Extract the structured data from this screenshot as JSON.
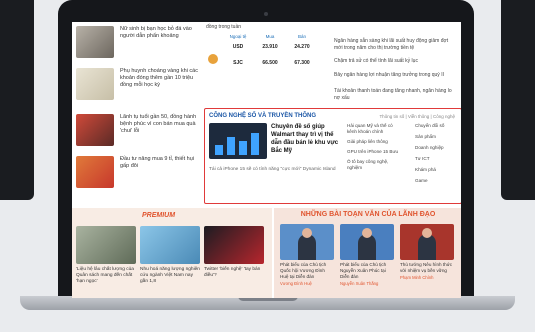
{
  "left_news": [
    {
      "title": "Nữ sinh bị bạn học bỏ đá vào người dẫn phẩn khoảng",
      "meta": "4h"
    },
    {
      "title": "Phụ huynh choáng vàng khi các khoản đóng thêm gần 10 triệu đồng mỗi học kỳ",
      "meta": "4h"
    },
    {
      "title": "Lãnh tụ tuổi gần 50, đồng hành bệnh phúc vì con bán mua quà 'chui' lỗi",
      "meta": "4h"
    },
    {
      "title": "Đầu tư nâng mua 9 tỉ, thiết hụi gấp đôi",
      "meta": "4h"
    }
  ],
  "stats": {
    "heading": "đồng trong tuần",
    "labels": [
      "Ngoại tệ",
      "Mua",
      "Bán"
    ],
    "rows": [
      {
        "label": "USD",
        "buy": "23.910",
        "sell": "24.270"
      },
      {
        "label": "SJC",
        "buy": "66.500",
        "sell": "67.300"
      }
    ]
  },
  "right_text": [
    "Ngân hàng sẵn sàng khi lãi suất huy động giảm đợt mới trong năm cho thị trường tiền tệ",
    "Chậm trả sử có thể tính lãi suất kỷ lục",
    "Bảy ngân hàng lợi nhuận tăng trưởng trong quý II",
    "Tài khoản thanh toán đang tăng nhanh, ngân hàng lo nợ xấu"
  ],
  "tech": {
    "title": "CÔNG NGHỆ SỐ VÀ TRUYỀN THÔNG",
    "more": "Thông tin số | Viễn thông | Công nghệ",
    "main_headline": "Chuyên đề số giúp Walmart thay trì vị thế dẫn đầu bán lẻ khu vực Bắc Mỹ",
    "sub": "Tái cả iPhone 15 sẽ có tính năng \"cực mới\" Dynamic Island",
    "list_a": [
      "Hải quan Mỹ và thế có kênh khoán chính",
      "Giải pháp liên thông",
      "GPU trên iPhone 15 Bưu",
      "Ô tô bay công nghệ, nghiệm"
    ],
    "list_b": [
      "Chuyển đổi số",
      "Sản phẩm",
      "Doanh nghiệp",
      "Tư ICT",
      "Khám phá",
      "Game"
    ]
  },
  "premium": {
    "title": "PREMIUM",
    "cards": [
      {
        "caption": "'Liệu hệ lâu chất lượng của Quân sách mang đến chất 'hạn ngọc'"
      },
      {
        "caption": "Nhu hoá năng lượng nghiên cứu ngành Việt Nam nay gần 1,8"
      },
      {
        "caption": "Twitter 'biến nghệ' 'tay bán điều'?"
      }
    ]
  },
  "leaders": {
    "title": "NHỮNG BÀI TOẠN VĂN CỦA LÃNH ĐẠO",
    "cards": [
      {
        "caption": "Phát biểu của Chủ tịch Quốc hội Vương Đình Huệ tại Diễn đàn",
        "author": "Vương Đình Huệ"
      },
      {
        "caption": "Phát biểu của Chủ tịch Nguyễn Xuân Phúc tại Diễn đàn",
        "author": "Nguyễn Xuân Thắng"
      },
      {
        "caption": "Thủ tướng Nêu hình thức với nhiệm vụ bền vững",
        "author": "Phạm Minh Chính"
      }
    ]
  }
}
